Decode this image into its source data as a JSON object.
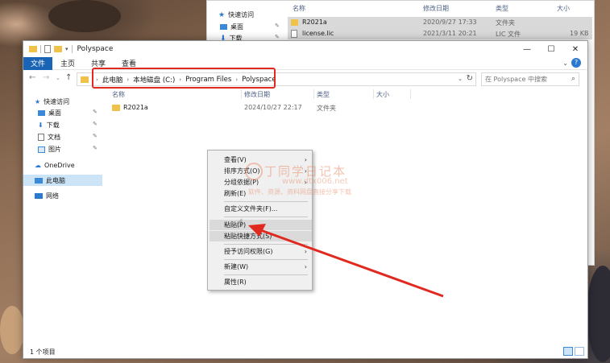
{
  "bg_window": {
    "nav": [
      {
        "label": "快速访问",
        "icon": "star-icon"
      },
      {
        "label": "桌面",
        "icon": "desktop-icon"
      },
      {
        "label": "下载",
        "icon": "download-icon"
      }
    ],
    "columns": {
      "name": "名称",
      "date": "修改日期",
      "type": "类型",
      "size": "大小"
    },
    "rows": [
      {
        "name": "R2021a",
        "date": "2020/9/27 17:33",
        "type": "文件夹",
        "size": ""
      },
      {
        "name": "license.lic",
        "date": "2021/3/11 20:21",
        "type": "LIC 文件",
        "size": "19 KB"
      }
    ]
  },
  "window": {
    "title": "Polyspace",
    "ribbon_tabs": [
      "文件",
      "主页",
      "共享",
      "查看"
    ],
    "help": "?",
    "breadcrumb": [
      "此电脑",
      "本地磁盘 (C:)",
      "Program Files",
      "Polyspace"
    ],
    "search_placeholder": "在 Polyspace 中搜索",
    "sidebar": [
      {
        "label": "快速访问",
        "icon": "star-icon"
      },
      {
        "label": "桌面",
        "icon": "desktop-icon"
      },
      {
        "label": "下载",
        "icon": "download-icon"
      },
      {
        "label": "文档",
        "icon": "document-icon"
      },
      {
        "label": "图片",
        "icon": "picture-icon"
      },
      {
        "label": "OneDrive",
        "icon": "cloud-icon"
      },
      {
        "label": "此电脑",
        "icon": "computer-icon"
      },
      {
        "label": "网络",
        "icon": "network-icon"
      }
    ],
    "columns": {
      "name": "名称",
      "date": "修改日期",
      "type": "类型",
      "size": "大小"
    },
    "files": [
      {
        "name": "R2021a",
        "date": "2024/10/27 22:17",
        "type": "文件夹"
      }
    ],
    "status": "1 个项目"
  },
  "context_menu": {
    "items": [
      "查看(V)",
      "排序方式(O)",
      "分组依据(P)",
      "刷新(E)",
      "自定义文件夹(F)...",
      "粘贴(P)",
      "粘贴快捷方式(S)",
      "授予访问权限(G)",
      "新建(W)",
      "属性(R)"
    ]
  },
  "watermark": {
    "title": "丁同学日记本",
    "url": "www.dtx006.net",
    "tagline": "软件、资源、资料网盘直接分享下载"
  },
  "colors": {
    "accent": "#1a64b6",
    "highlight": "#e02a20",
    "selection": "#cce4f7"
  }
}
